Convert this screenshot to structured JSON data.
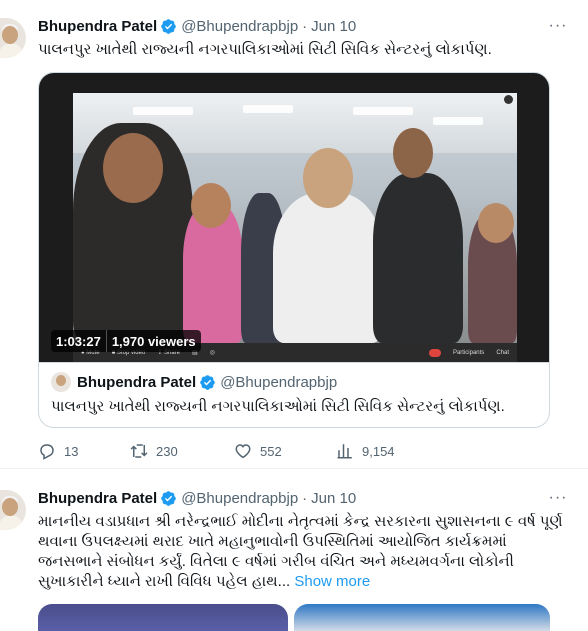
{
  "tweet1": {
    "author": {
      "name": "Bhupendra Patel",
      "handle": "@Bhupendrapbjp",
      "date": "Jun 10"
    },
    "text": "પાલનપુર ખાતેથી રાજ્યની નગરપાલિકાઓમાં સિટી સિવિક સેન્ટરનું લોકાર્પણ.",
    "video": {
      "duration": "1:03:27",
      "viewers": "1,970 viewers"
    },
    "quote": {
      "author": {
        "name": "Bhupendra Patel",
        "handle": "@Bhupendrapbjp"
      },
      "text": "પાલનપુર ખાતેથી રાજ્યની નગરપાલિકાઓમાં સિટી સિવિક સેન્ટરનું લોકાર્પણ."
    },
    "actions": {
      "replies": "13",
      "retweets": "230",
      "likes": "552",
      "views": "9,154"
    }
  },
  "tweet2": {
    "author": {
      "name": "Bhupendra Patel",
      "handle": "@Bhupendrapbjp",
      "date": "Jun 10"
    },
    "text": "માનનીય વડાપ્રધાન શ્રી નરેન્દ્રભાઈ મોદીના નેતૃત્વમાં કેન્દ્ર સરકારના સુશાસનના ૯ વર્ષ પૂર્ણ થવાના ઉપલક્ષ્યમાં થરાદ ખાતે મહાનુભાવોની ઉપસ્થિતિમાં આયોજિત કાર્યક્રમમાં જનસભાને સંબોધન કર્યું. વિતેલા ૯ વર્ષમાં ગરીબ વંચિત અને મધ્યમવર્ગના લોકોની સુખાકારીને ધ્યાને રાખી વિવિધ પહેલ હાથ...",
    "show_more": "Show more"
  },
  "icons": [
    "verified-badge-icon",
    "more-icon",
    "reply-icon",
    "retweet-icon",
    "like-icon",
    "views-icon"
  ],
  "colors": {
    "accent": "#1d9bf0",
    "secondary_text": "#536471",
    "border": "#cfd9de"
  }
}
